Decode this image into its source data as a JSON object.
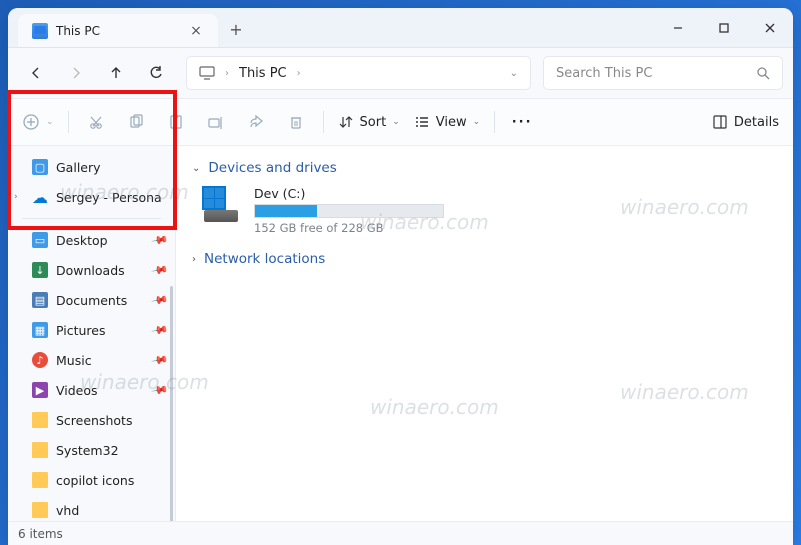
{
  "tab": {
    "title": "This PC"
  },
  "breadcrumb": {
    "location": "This PC"
  },
  "search": {
    "placeholder": "Search This PC"
  },
  "toolbar": {
    "sort_label": "Sort",
    "view_label": "View",
    "details_label": "Details"
  },
  "sidebar": {
    "gallery": "Gallery",
    "onedrive": "Sergey - Persona",
    "desktop": "Desktop",
    "downloads": "Downloads",
    "documents": "Documents",
    "pictures": "Pictures",
    "music": "Music",
    "videos": "Videos",
    "screenshots": "Screenshots",
    "system32": "System32",
    "copilot": "copilot icons",
    "vhd": "vhd"
  },
  "groups": {
    "devices": "Devices and drives",
    "network": "Network locations"
  },
  "drive": {
    "name": "Dev (C:)",
    "free_text": "152 GB free of 228 GB",
    "used_percent": 33
  },
  "status": {
    "items": "6 items"
  },
  "watermark": "winaero.com"
}
